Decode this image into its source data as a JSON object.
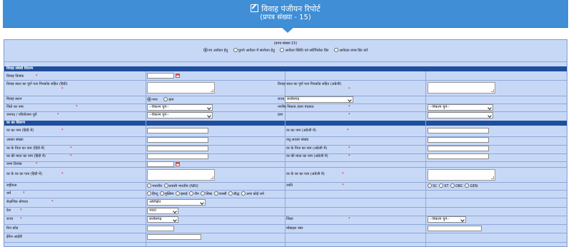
{
  "header": {
    "title": "विवाह पंजीयन रिपोर्ट",
    "subtitle": "(प्रपत्र संख्या - 15)"
  },
  "form": {
    "prapatra_note": "(प्रपत्र संख्या-15)",
    "radio_options": [
      "नए आवेदन हेतु",
      "पुराने आवेदन में संशोधन हेतु",
      "आवेदन स्थिति एवं सर्टिफिकेट प्रिंट",
      "आवेदक प्रपत्र प्रिंट करें"
    ],
    "sections": {
      "vivah": "विवाह संबंधी विवरण",
      "var": "वर का विवरण"
    },
    "labels": {
      "vivah_dinank": "विवाह दिनांक",
      "vivah_sthal_hindi": "विवाह स्थल का पूर्ण पता पिनकोड सहित (हिंदी)",
      "vivah_sthal_english": "विवाह स्थल का पूर्ण पता पिनकोड सहित (अंग्रेजी)",
      "vivah_sthan": "विवाह स्थान",
      "rajya": "राज्य",
      "zile_ka_naam": "जिले का नाम",
      "nagar_nikay": "नगरीय निकाय /ग्राम पंचायत",
      "janpad": "जनपद / परियोजना चुनें",
      "gram": "ग्राम",
      "var_naam_hindi": "वर का नाम (हिंदी में)",
      "var_naam_english": "वर का नाम (अंग्रेजी में)",
      "aadhar": "आधार संख्या",
      "dus_aadhar": "वधू-आधार संख्या",
      "pita_hindi": "वर के पिता का नाम (हिंदी में)",
      "pita_english": "वर के पिता का नाम (अंग्रेजी में)",
      "mata_hindi": "वर की माता का नाम (हिंदी में)",
      "mata_english": "वर की माता का नाम (अंग्रेजी में)",
      "janm_tithi": "जन्म दिनांक",
      "pata_hindi": "वर के घर का पता (हिंदी में)",
      "pata_english": "वर के घर का पता (अंग्रेजी में)",
      "rashtriyata": "राष्ट्रीयता",
      "jati": "जाति",
      "dharm": "धर्म",
      "shaikshanik_yogyata": "शैक्षणिक योग्यता",
      "desh": "देश",
      "rajya2": "राज्य",
      "jila": "जिला",
      "pin_code": "पिन कोड",
      "mobile": "मोबाइल नंबर",
      "email": "ईमेल आईडी"
    },
    "required_mark": "*",
    "values": {
      "vivah_sthan_opts": [
        "नगर",
        "ग्राम"
      ],
      "rajya_value": "छत्तीसगढ़",
      "select_placeholder": "--विकल्प चुनें--",
      "rashtriyata_opts": [
        "भारतीय",
        "प्रवासी भारतीय (NRI)"
      ],
      "jati_opts": [
        "SC",
        "ST",
        "OBC",
        "GEN"
      ],
      "dharm_opts": [
        "हिन्दू",
        "मुस्लिम",
        "इसाई",
        "जैन",
        "सिख",
        "पारसी",
        "बौद्ध",
        "अन्य कोई धर्म"
      ],
      "shaikshanik_value": "अशिक्षित",
      "desh_value": "भारत",
      "rajya2_value": "छत्तीसगढ़",
      "jila_value": "--विकल्प चुनें--"
    }
  }
}
